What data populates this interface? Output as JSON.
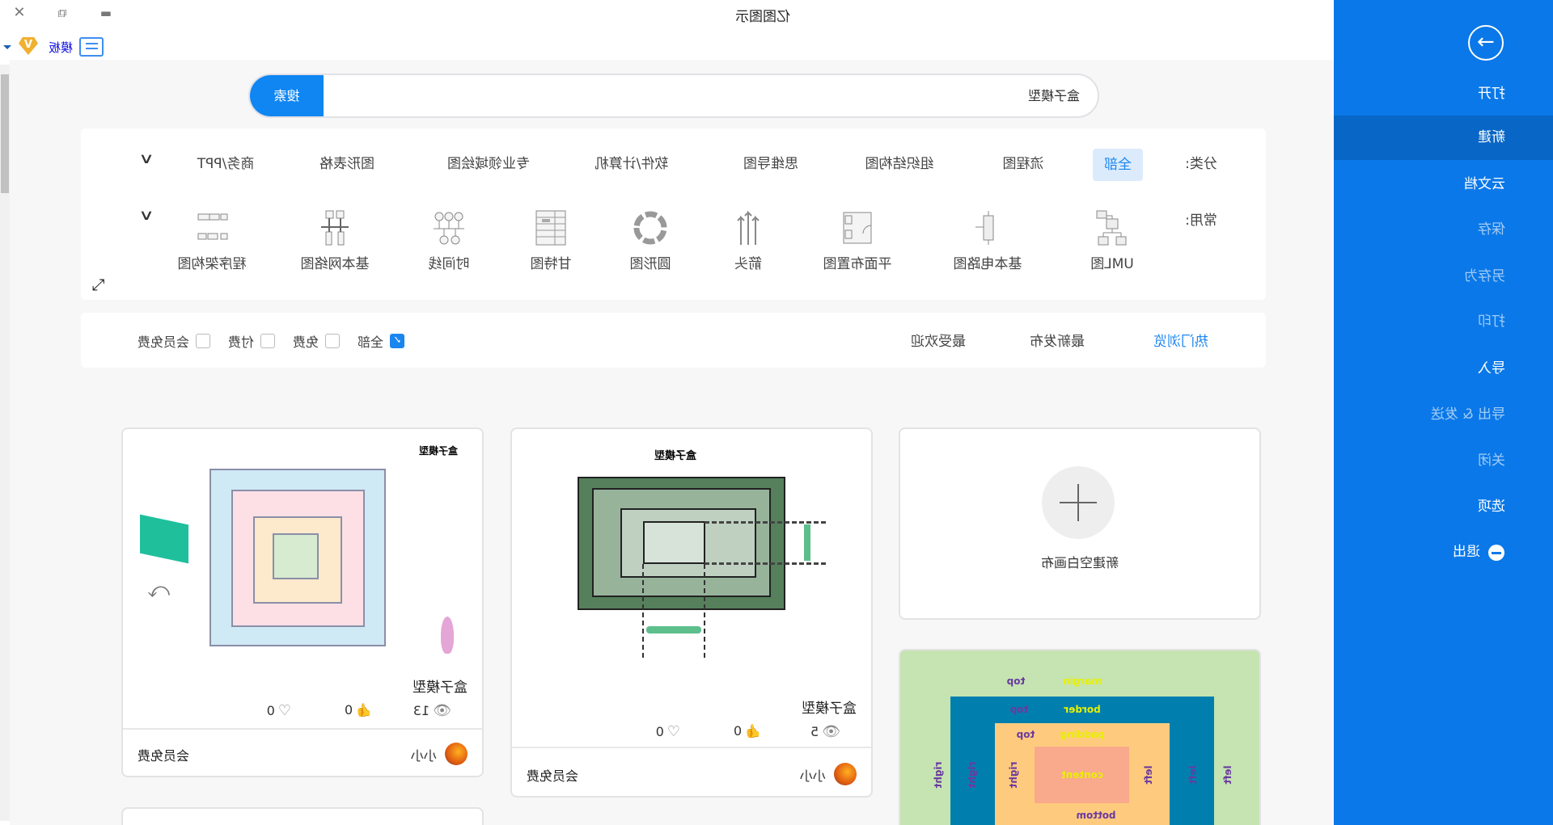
{
  "window": {
    "title": "亿图图示",
    "minimize_icon": "minimize-icon",
    "restore_icon": "restore-icon",
    "close_icon": "close-icon"
  },
  "toolbar": {
    "template_label": "模板",
    "vip_badge": "V",
    "comment_icon": "comment-icon"
  },
  "sidebar": {
    "items": [
      {
        "label": "打开"
      },
      {
        "label": "新建"
      },
      {
        "label": "云文档"
      },
      {
        "label": "保存"
      },
      {
        "label": "另存为"
      },
      {
        "label": "打印"
      },
      {
        "label": "导入"
      },
      {
        "label": "导出 & 发送"
      },
      {
        "label": "关闭"
      },
      {
        "label": "选项"
      },
      {
        "label": "退出"
      }
    ],
    "active": "新建",
    "colors": {
      "background": "#0a78e8",
      "active": "#0866c6"
    }
  },
  "search": {
    "value": "盒子模型",
    "button": "搜索"
  },
  "categories": {
    "label": "分类:",
    "items": [
      "全部",
      "流程图",
      "组织结构图",
      "思维导图",
      "软件/计算机",
      "专业领域绘图",
      "图形表格",
      "商务/PPT"
    ],
    "selected": "全部"
  },
  "common": {
    "label": "常用:",
    "items": [
      "UML图",
      "基本电路图",
      "平面布置图",
      "箭头",
      "圆形图",
      "甘特图",
      "时间线",
      "基本网络图",
      "程序架构图"
    ]
  },
  "filters": {
    "sort_tabs": [
      "热门浏览",
      "最新发布",
      "最受欢迎"
    ],
    "active_sort": "热门浏览",
    "price": [
      {
        "label": "全部",
        "checked": true
      },
      {
        "label": "免费",
        "checked": false
      },
      {
        "label": "付费",
        "checked": false
      },
      {
        "label": "会员免费",
        "checked": false
      }
    ]
  },
  "new_blank": {
    "label": "新建空白画布"
  },
  "templates": [
    {
      "preview_title": "盒子模型",
      "title": "盒子模型",
      "views": "5",
      "likes": "0",
      "favorites": "0",
      "author": "小小",
      "price": "会员免费"
    },
    {
      "preview_title": "盒子模型",
      "title": "盒子模型",
      "views": "13",
      "likes": "0",
      "favorites": "0",
      "author": "小小",
      "price": "会员免费"
    }
  ],
  "colored_preview": {
    "labels": {
      "margin": "margin",
      "border": "border",
      "padding": "padding",
      "content": "content",
      "top": "top",
      "bottom": "bottom",
      "left": "left",
      "right": "right"
    },
    "colors": {
      "margin": "#c5e4b1",
      "border": "#007fae",
      "padding": "#fecb7e",
      "content": "#f9a98c"
    }
  }
}
